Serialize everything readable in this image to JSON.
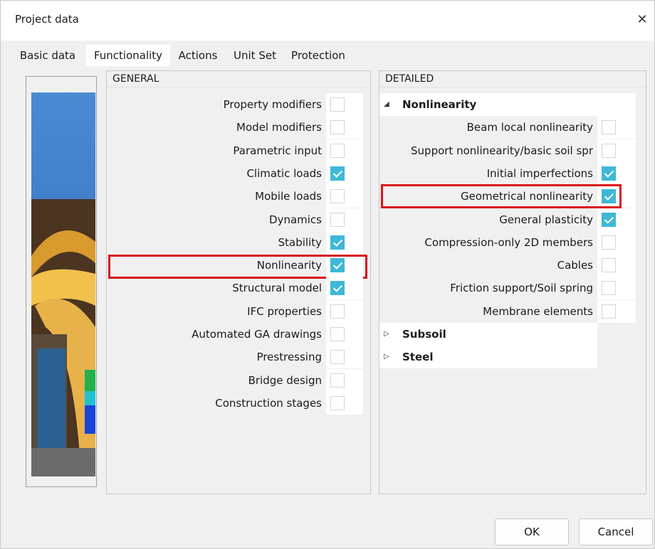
{
  "window": {
    "title": "Project data",
    "close_glyph": "✕"
  },
  "tabs": [
    {
      "label": "Basic data",
      "active": false
    },
    {
      "label": "Functionality",
      "active": true
    },
    {
      "label": "Actions",
      "active": false
    },
    {
      "label": "Unit Set",
      "active": false
    },
    {
      "label": "Protection",
      "active": false
    }
  ],
  "general": {
    "header": "GENERAL",
    "items": [
      {
        "label": "Property modifiers",
        "checked": false
      },
      {
        "label": "Model modifiers",
        "checked": false
      },
      {
        "label": "Parametric input",
        "checked": false
      },
      {
        "label": "Climatic loads",
        "checked": true
      },
      {
        "label": "Mobile loads",
        "checked": false
      },
      {
        "label": "Dynamics",
        "checked": false
      },
      {
        "label": "Stability",
        "checked": true
      },
      {
        "label": "Nonlinearity",
        "checked": true,
        "highlighted": true
      },
      {
        "label": "Structural model",
        "checked": true
      },
      {
        "label": "IFC properties",
        "checked": false
      },
      {
        "label": "Automated GA drawings",
        "checked": false
      },
      {
        "label": "Prestressing",
        "checked": false
      },
      {
        "label": "Bridge design",
        "checked": false
      },
      {
        "label": "Construction stages",
        "checked": false
      }
    ]
  },
  "detailed": {
    "header": "DETAILED",
    "groups": [
      {
        "label": "Nonlinearity",
        "expanded": true,
        "expander_glyph": "◢",
        "items": [
          {
            "label": "Beam local nonlinearity",
            "checked": false
          },
          {
            "label": "Support nonlinearity/basic soil spr",
            "checked": false
          },
          {
            "label": "Initial imperfections",
            "checked": true
          },
          {
            "label": "Geometrical nonlinearity",
            "checked": true,
            "highlighted": true
          },
          {
            "label": "General plasticity",
            "checked": true
          },
          {
            "label": "Compression-only 2D members",
            "checked": false
          },
          {
            "label": "Cables",
            "checked": false
          },
          {
            "label": "Friction support/Soil spring",
            "checked": false
          },
          {
            "label": "Membrane elements",
            "checked": false
          }
        ]
      },
      {
        "label": "Subsoil",
        "expanded": false,
        "expander_glyph": "▷",
        "items": []
      },
      {
        "label": "Steel",
        "expanded": false,
        "expander_glyph": "▷",
        "items": []
      }
    ]
  },
  "buttons": {
    "ok": "OK",
    "cancel": "Cancel"
  },
  "colors": {
    "check_on": "#3fb8d7",
    "highlight": "#d9141a"
  }
}
